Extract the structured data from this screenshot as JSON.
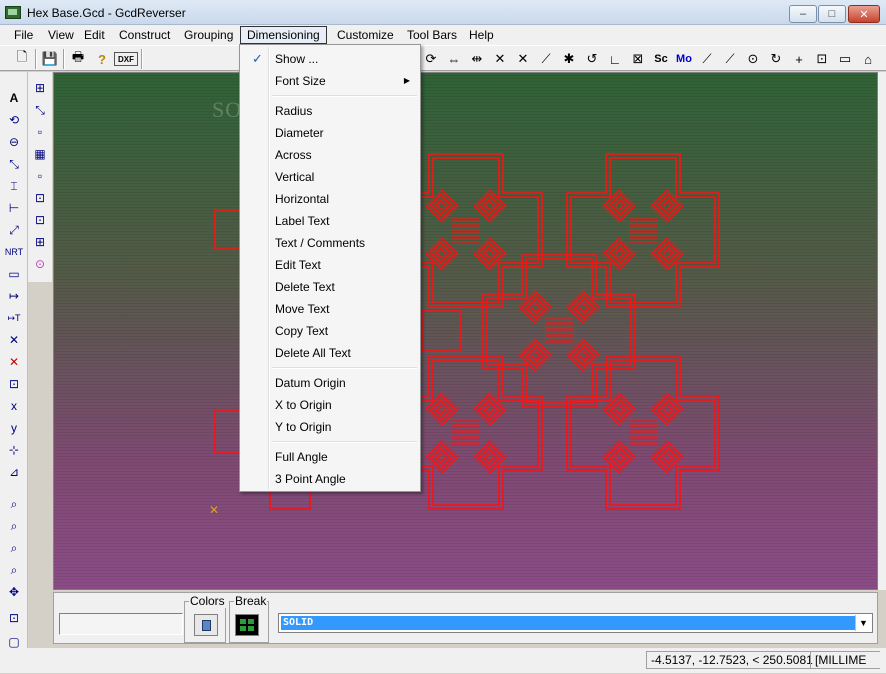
{
  "window": {
    "title": "Hex Base.Gcd - GcdReverser",
    "min_glyph": "–",
    "max_glyph": "□",
    "close_glyph": "✕"
  },
  "menubar": {
    "items": [
      "File",
      "View",
      "Edit",
      "Construct",
      "Grouping",
      "Dimensioning",
      "Customize",
      "Tool Bars",
      "Help"
    ],
    "active": "Dimensioning"
  },
  "toolbar": {
    "buttons": [
      {
        "name": "new-icon",
        "glyph": "🗋"
      },
      {
        "name": "save-icon",
        "glyph": "💾"
      },
      {
        "name": "print-icon",
        "glyph": "🖶"
      },
      {
        "name": "help-icon",
        "glyph": "?"
      },
      {
        "name": "dxf-out-icon",
        "glyph": "DXF"
      }
    ],
    "right_buttons": [
      "⟳",
      "⇔",
      "⇹",
      "✕",
      "✕",
      "⟋",
      "✱",
      "↺",
      "∟",
      "⊠",
      "Sc",
      "Mo",
      "⟋",
      "⟋",
      "⊙",
      "↻",
      "+",
      "⊡",
      "▭",
      "⌂"
    ]
  },
  "left_toolbar": {
    "buttons": [
      "A",
      "⟲",
      "⊖",
      "⤡",
      "⌶",
      "⊢",
      "⤢",
      "NRT",
      "▭",
      "↦",
      "↦T",
      "✕",
      "✕",
      "⊡",
      "x",
      "y",
      "⊹",
      "⊿",
      "⌕",
      "⌕",
      "⌕",
      "⌕",
      "✥",
      "⊡",
      "▢",
      "⊞"
    ]
  },
  "left_toolbar2": {
    "buttons": [
      "⊞",
      "⤡",
      "▫",
      "▦",
      "▫",
      "⊡",
      "⊡",
      "⊞",
      "⊙"
    ]
  },
  "canvas": {
    "watermark": "SOFTPEDIA",
    "colors": {
      "top": "#2f6236",
      "bottom": "#8a4c85",
      "drawing": "#ff1010"
    }
  },
  "bottom_panel": {
    "command_value": "",
    "colors_label": "Colors",
    "break_label": "Break",
    "line_style": "SOLID"
  },
  "status": {
    "coords": "-4.5137, -12.7523, < 250.5081",
    "units": "[MILLIME"
  },
  "dimensioning_menu": {
    "groups": [
      [
        {
          "label": "Show ...",
          "checked": true,
          "submenu": false
        },
        {
          "label": "Font Size",
          "checked": false,
          "submenu": true
        }
      ],
      [
        {
          "label": "Radius"
        },
        {
          "label": "Diameter"
        },
        {
          "label": "Across"
        },
        {
          "label": "Vertical"
        },
        {
          "label": "Horizontal"
        },
        {
          "label": "Label Text"
        },
        {
          "label": "Text / Comments"
        },
        {
          "label": "Edit Text"
        },
        {
          "label": "Delete Text"
        },
        {
          "label": "Move Text"
        },
        {
          "label": "Copy Text"
        },
        {
          "label": "Delete All Text"
        }
      ],
      [
        {
          "label": "Datum Origin"
        },
        {
          "label": "X to Origin"
        },
        {
          "label": "Y to Origin"
        }
      ],
      [
        {
          "label": "Full Angle"
        },
        {
          "label": "3 Point Angle"
        }
      ]
    ],
    "check_glyph": "✓",
    "arrow_glyph": "▶"
  }
}
